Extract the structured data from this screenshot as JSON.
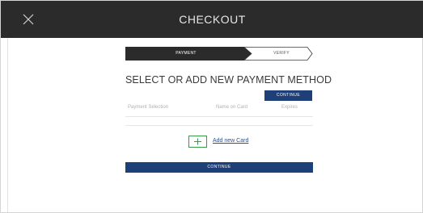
{
  "header": {
    "title": "CHECKOUT",
    "close_icon": "close-icon"
  },
  "stepper": {
    "steps": [
      {
        "label": "PAYMENT",
        "state": "active"
      },
      {
        "label": "VERIFY",
        "state": "inactive"
      }
    ]
  },
  "main": {
    "heading": "SELECT OR ADD NEW PAYMENT METHOD",
    "continue_top_label": "CONTINUE",
    "columns": [
      "Payment Selection",
      "Name on Card",
      "Expires"
    ],
    "add_card_label": "Add new Card",
    "add_icon": "plus-icon",
    "continue_bottom_label": "CONTINUE"
  },
  "colors": {
    "topbar": "#2b2b2b",
    "primary_button": "#1e3f78",
    "add_accent": "#3a9a47",
    "link": "#2c4f8a"
  }
}
